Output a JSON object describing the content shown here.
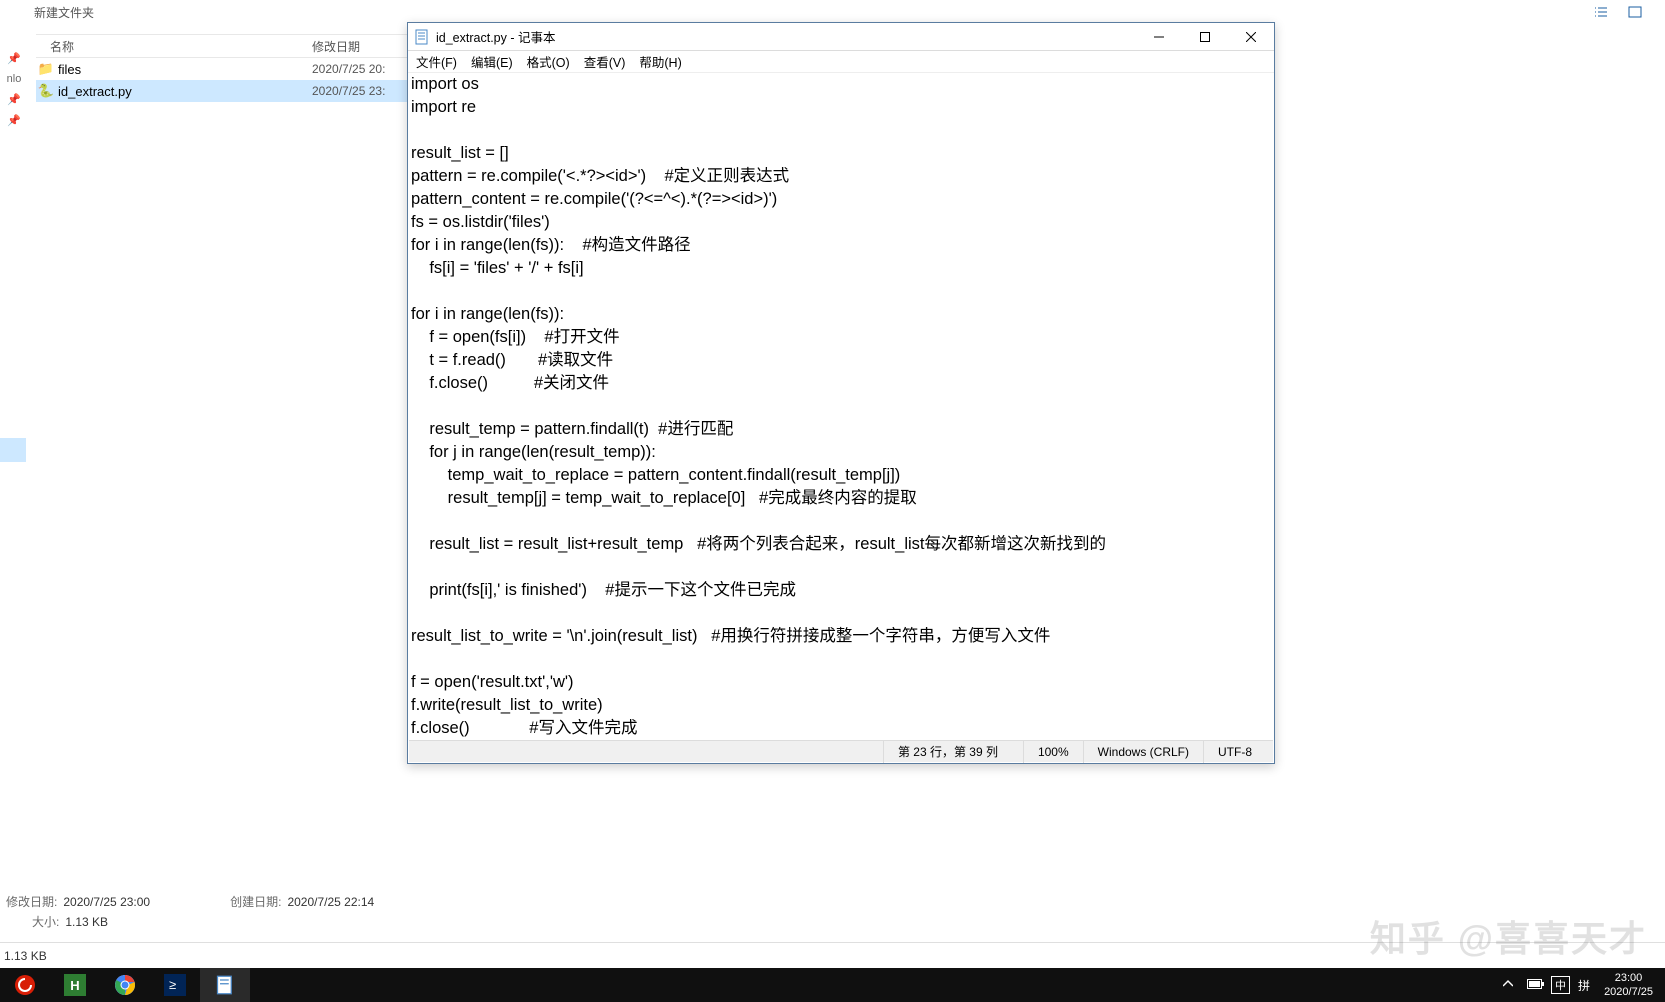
{
  "explorer": {
    "folder_title": "新建文件夹",
    "columns": {
      "name": "名称",
      "date": "修改日期"
    },
    "files": [
      {
        "icon": "folder",
        "name": "files",
        "date": "2020/7/25 20:"
      },
      {
        "icon": "python",
        "name": "id_extract.py",
        "date": "2020/7/25 23:"
      }
    ],
    "side_label": "nlo",
    "details": {
      "mod_label": "修改日期:",
      "mod_value": "2020/7/25 23:00",
      "create_label": "创建日期:",
      "create_value": "2020/7/25 22:14",
      "size_label": "大小:",
      "size_value": "1.13 KB"
    },
    "statusbar_text": "1.13 KB"
  },
  "notepad": {
    "title": "id_extract.py - 记事本",
    "menus": {
      "file": "文件(F)",
      "edit": "编辑(E)",
      "format": "格式(O)",
      "view": "查看(V)",
      "help": "帮助(H)"
    },
    "content": "import os\nimport re\n\nresult_list = []\npattern = re.compile('<.*?><id>')    #定义正则表达式\npattern_content = re.compile('(?<=^<).*(?=><id>)')\nfs = os.listdir('files')\nfor i in range(len(fs)):    #构造文件路径\n    fs[i] = 'files' + '/' + fs[i]\n\nfor i in range(len(fs)):\n    f = open(fs[i])    #打开文件\n    t = f.read()       #读取文件\n    f.close()          #关闭文件\n\n    result_temp = pattern.findall(t)  #进行匹配\n    for j in range(len(result_temp)):\n        temp_wait_to_replace = pattern_content.findall(result_temp[j])\n        result_temp[j] = temp_wait_to_replace[0]   #完成最终内容的提取\n\n    result_list = result_list+result_temp   #将两个列表合起来，result_list每次都新增这次新找到的\n\n    print(fs[i],' is finished')    #提示一下这个文件已完成\n\nresult_list_to_write = '\\n'.join(result_list)   #用换行符拼接成整一个字符串，方便写入文件\n\nf = open('result.txt','w')\nf.write(result_list_to_write)\nf.close()             #写入文件完成",
    "status": {
      "pos": "第 23 行，第 39 列",
      "zoom": "100%",
      "eol": "Windows (CRLF)",
      "encoding": "UTF-8"
    }
  },
  "taskbar": {
    "ime_lang": "中",
    "ime_mode": "拼",
    "clock_time": "23:00",
    "clock_date": "2020/7/25"
  },
  "watermark": "知乎 @喜喜天才"
}
